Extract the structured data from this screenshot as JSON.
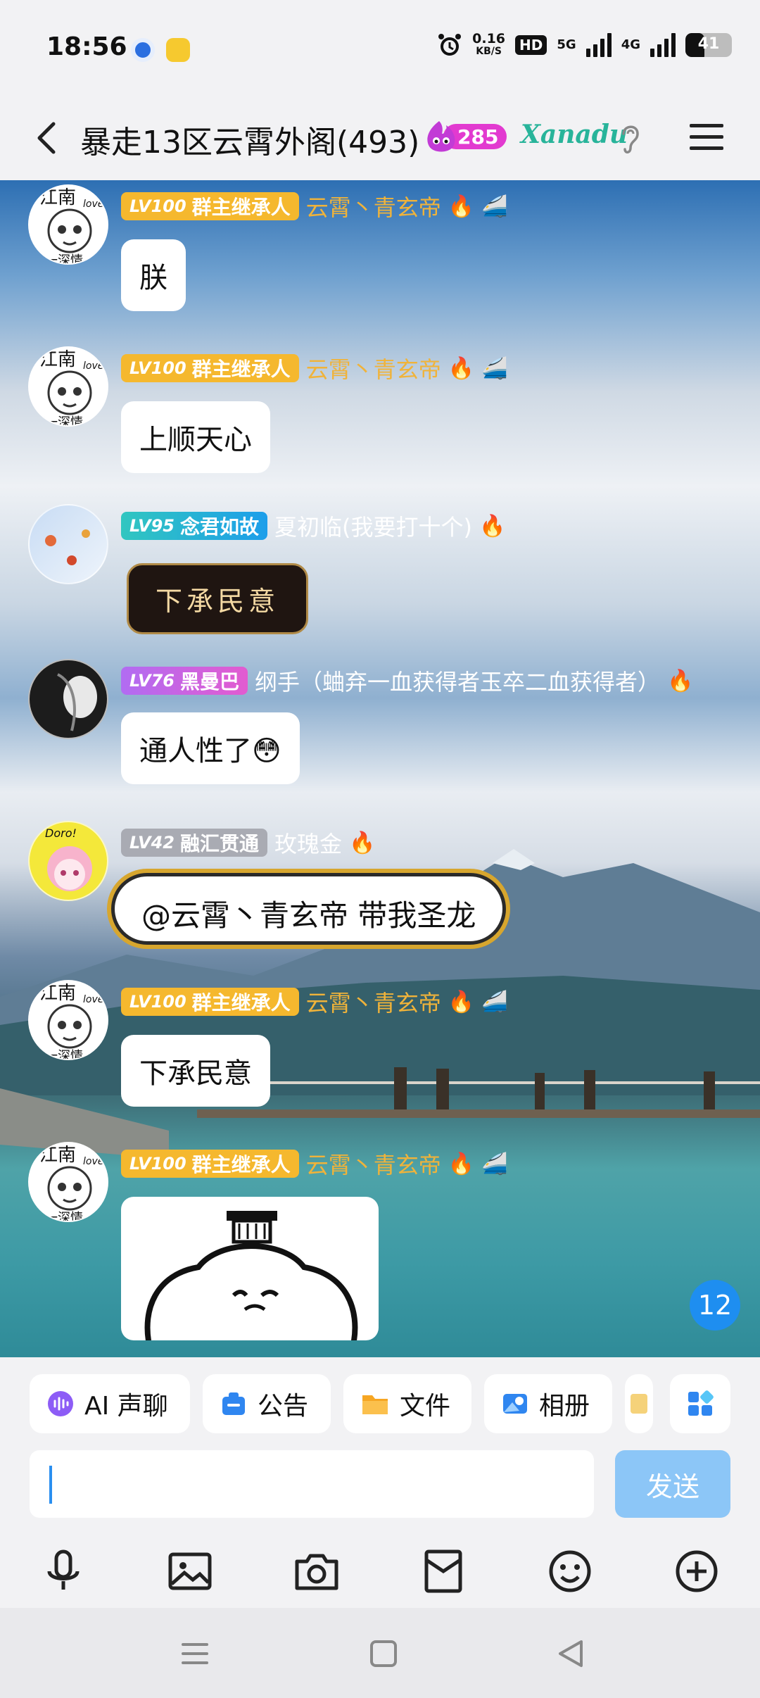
{
  "status_bar": {
    "time": "18:56",
    "net_speed_value": "0.16",
    "net_speed_unit": "KB/S",
    "hd_label": "HD",
    "network_5g": "5G",
    "network_4g": "4G",
    "battery_level": "41",
    "battery_fraction": 0.41
  },
  "header": {
    "title": "暴走13区云霄外阁(493)",
    "flame_count": "285",
    "brand_badge": "Xanadu"
  },
  "messages": [
    {
      "level": "LV100",
      "title": "群主继承人",
      "nick": "云霄丶青玄帝",
      "text": "朕"
    },
    {
      "level": "LV100",
      "title": "群主继承人",
      "nick": "云霄丶青玄帝",
      "text": "上顺天心"
    },
    {
      "level": "LV95",
      "title": "念君如故",
      "nick": "夏初临(我要打十个)",
      "text": "下承民意"
    },
    {
      "level": "LV76",
      "title": "黑曼巴",
      "nick": "纲手（蛐弃一血获得者玉卒二血获得者）",
      "text": "通人性了😳"
    },
    {
      "level": "LV42",
      "title": "融汇贯通",
      "nick": "玫瑰金",
      "text": "@云霄丶青玄帝 带我圣龙"
    },
    {
      "level": "LV100",
      "title": "群主继承人",
      "nick": "云霄丶青玄帝",
      "text": "下承民意"
    },
    {
      "level": "LV100",
      "title": "群主继承人",
      "nick": "云霄丶青玄帝",
      "text": ""
    }
  ],
  "avatar_text": {
    "line1": "江南",
    "line2": "love",
    "line3": "第一深情",
    "doro": "Doro!"
  },
  "unread_count": "12",
  "quick_actions": {
    "ai_voice": "AI 声聊",
    "notice": "公告",
    "files": "文件",
    "album": "相册"
  },
  "input": {
    "value": "",
    "placeholder": ""
  },
  "send_label": "发送",
  "toolbar_icons": [
    "microphone-icon",
    "image-icon",
    "camera-icon",
    "red-packet-icon",
    "emoji-icon",
    "plus-icon"
  ],
  "colors": {
    "send_disabled": "#8cc6f7",
    "accent_blue": "#1e8ef0",
    "gold_level": "#f5b82e",
    "gold_nick": "#f0b33a"
  }
}
